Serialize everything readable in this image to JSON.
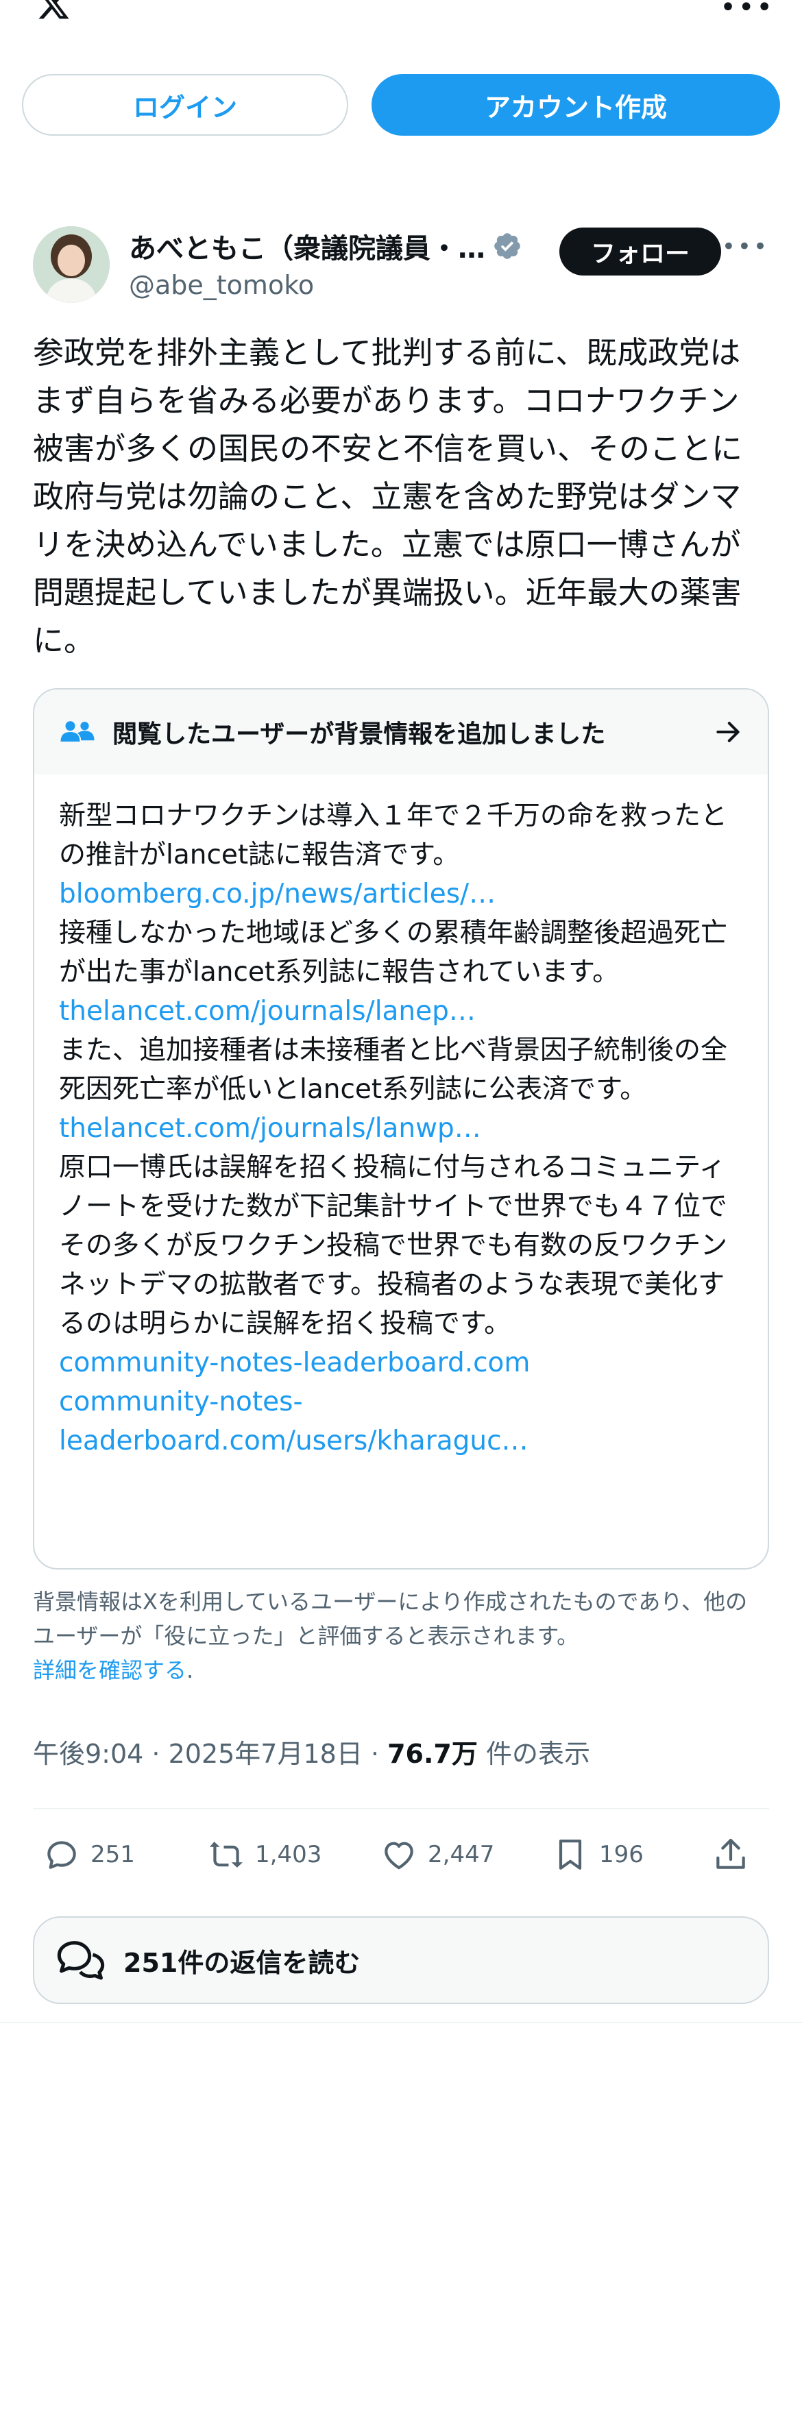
{
  "header": {
    "logo_icon": "x-logo-icon",
    "more_icon": "more-horizontal-icon"
  },
  "auth": {
    "login_label": "ログイン",
    "signup_label": "アカウント作成"
  },
  "author": {
    "name": "あべともこ（衆議院議員・…",
    "handle": "@abe_tomoko",
    "verified_icon": "verified-badge-icon",
    "follow_label": "フォロー"
  },
  "tweet": {
    "text": "参政党を排外主義として批判する前に、既成政党はまず自らを省みる必要があります。コロナワクチン被害が多くの国民の不安と不信を買い、そのことに政府与党は勿論のこと、立憲を含めた野党はダンマリを決め込んでいました。立憲では原口一博さんが問題提起していましたが異端扱い。近年最大の薬害に。"
  },
  "community_note": {
    "title": "閲覧したユーザーが背景情報を追加しました",
    "para1": "新型コロナワクチンは導入１年で２千万の命を救ったとの推計がlancet誌に報告済です。",
    "link1": "bloomberg.co.jp/news/articles/…",
    "para2": "接種しなかった地域ほど多くの累積年齢調整後超過死亡が出た事がlancet系列誌に報告されています。",
    "link2": "thelancet.com/journals/lanep…",
    "para3": "また、追加接種者は未接種者と比べ背景因子統制後の全死因死亡率が低いとlancet系列誌に公表済です。",
    "link3": "thelancet.com/journals/lanwp…",
    "para4": "原口一博氏は誤解を招く投稿に付与されるコミュニティノートを受けた数が下記集計サイトで世界でも４７位でその多くが反ワクチン投稿で世界でも有数の反ワクチンネットデマの拡散者です。投稿者のような表現で美化するのは明らかに誤解を招く投稿です。",
    "link4": "community-notes-leaderboard.com",
    "link5a": "community-notes-",
    "link5b": "leaderboard.com/users/kharaguc…",
    "footer_text": "背景情報はXを利用しているユーザーにより作成されたものであり、他のユーザーが「役に立った」と評価すると表示されます。",
    "footer_link": "詳細を確認する",
    "footer_end": "."
  },
  "meta": {
    "time": "午後9:04",
    "sep": " · ",
    "date": "2025年7月18日",
    "views": "76.7万",
    "views_suffix": " 件の表示"
  },
  "actions": {
    "replies": "251",
    "retweets": "1,403",
    "likes": "2,447",
    "bookmarks": "196"
  },
  "read_replies": {
    "label": "251件の返信を読む"
  },
  "colors": {
    "accent": "#1d9bf0",
    "text": "#0f1419",
    "secondary": "#536471",
    "border": "#cfd9de"
  }
}
